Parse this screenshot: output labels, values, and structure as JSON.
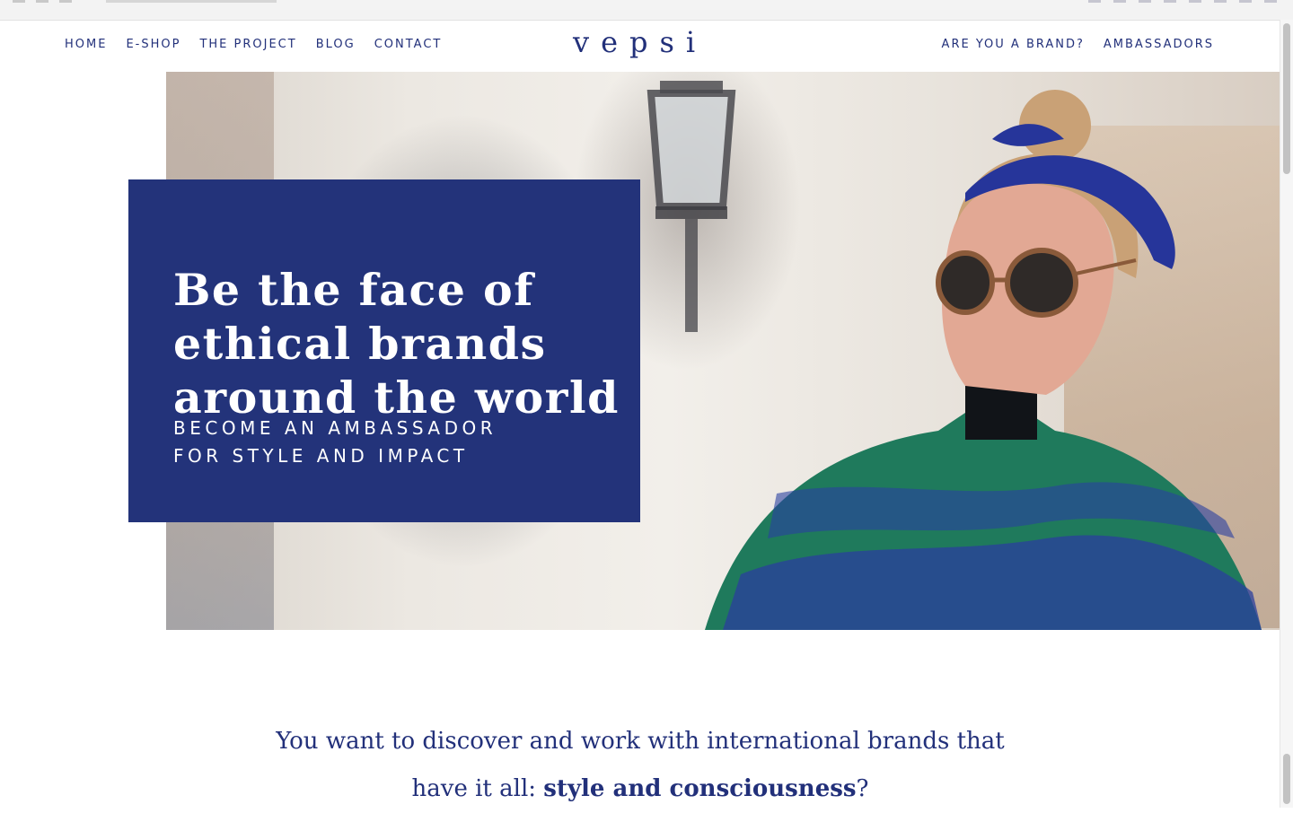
{
  "brand": {
    "logo_text": "vepsi",
    "primary_color": "#23337a"
  },
  "nav": {
    "left": [
      {
        "label": "HOME"
      },
      {
        "label": "E-SHOP"
      },
      {
        "label": "THE PROJECT"
      },
      {
        "label": "BLOG"
      },
      {
        "label": "CONTACT"
      }
    ],
    "right": [
      {
        "label": "ARE YOU A BRAND?"
      },
      {
        "label": "AMBASSADORS"
      }
    ]
  },
  "hero": {
    "title_lines": [
      "Be the face of",
      "ethical brands",
      "around the world"
    ],
    "subtitle_lines": [
      "BECOME AN AMBASSADOR",
      "FOR STYLE AND IMPACT"
    ],
    "box_color": "#23337a"
  },
  "intro": {
    "line1": "You want to discover and work with international brands that",
    "line2_prefix": "have it all: ",
    "line2_bold": "style and consciousness",
    "line2_suffix": "?"
  }
}
